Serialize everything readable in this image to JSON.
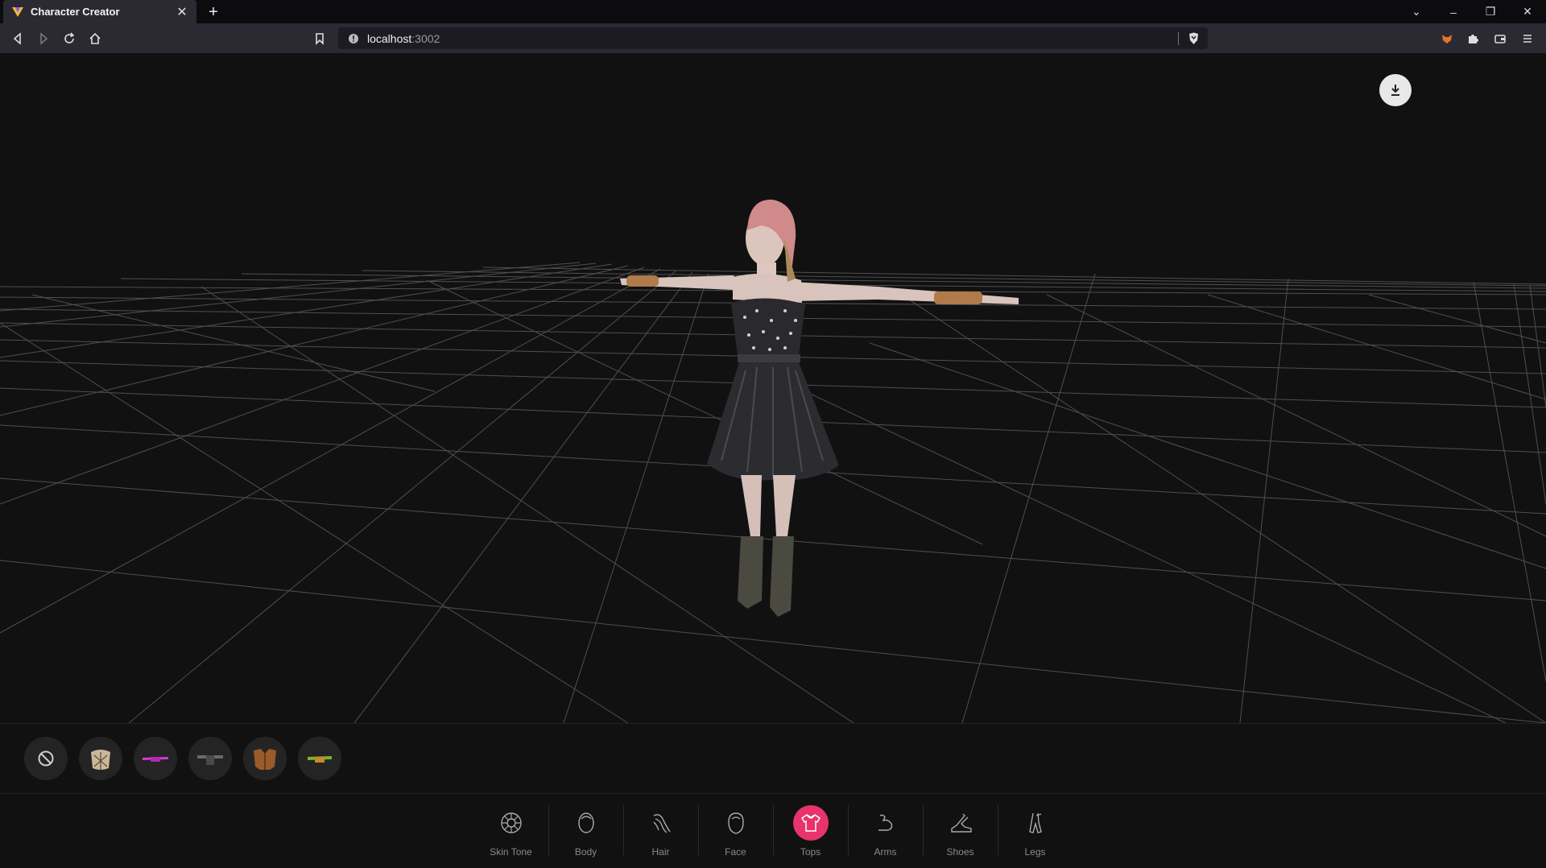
{
  "browser": {
    "tab_title": "Character Creator",
    "url_host": "localhost",
    "url_port": ":3002"
  },
  "items": [
    {
      "name": "none",
      "color": "#cccccc"
    },
    {
      "name": "lace-top",
      "color": "#c9b79a"
    },
    {
      "name": "pink-top",
      "color": "#d63ad6"
    },
    {
      "name": "dark-top",
      "color": "#6a6a6a"
    },
    {
      "name": "brown-jacket",
      "color": "#9a5a2a"
    },
    {
      "name": "green-top",
      "color": "#7ab52a"
    }
  ],
  "categories": [
    {
      "label": "Skin Tone",
      "icon": "skin-tone-icon"
    },
    {
      "label": "Body",
      "icon": "body-icon"
    },
    {
      "label": "Hair",
      "icon": "hair-icon"
    },
    {
      "label": "Face",
      "icon": "face-icon"
    },
    {
      "label": "Tops",
      "icon": "tops-icon",
      "active": true
    },
    {
      "label": "Arms",
      "icon": "arms-icon"
    },
    {
      "label": "Shoes",
      "icon": "shoes-icon"
    },
    {
      "label": "Legs",
      "icon": "legs-icon"
    }
  ],
  "colors": {
    "accent": "#e8336d",
    "background": "#111111"
  }
}
